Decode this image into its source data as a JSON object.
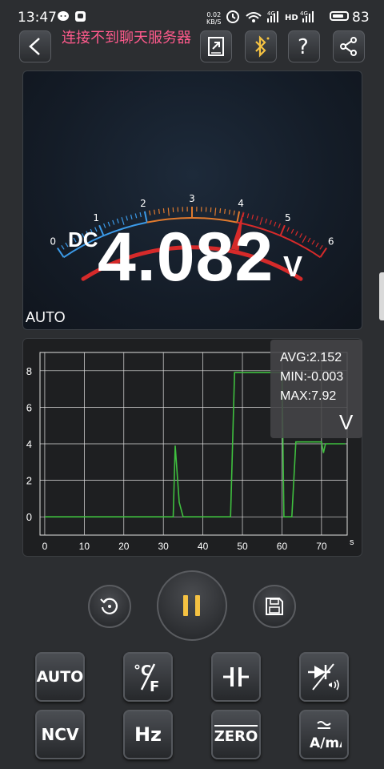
{
  "status_bar": {
    "time": "13:47",
    "net_speed": "0.02",
    "net_unit": "KB/S",
    "battery": "83",
    "battery_level": 0.83
  },
  "toolbar": {
    "title": "连接不到聊天服务器"
  },
  "meter": {
    "scale_labels": [
      "0",
      "1",
      "2",
      "3",
      "4",
      "5",
      "6"
    ],
    "needle_value": 4.082,
    "mode": "DC",
    "reading": "4.082",
    "unit": "V",
    "range": "AUTO",
    "colors": {
      "low": "#3b9ae8",
      "mid": "#e07a2e",
      "high": "#d62a2a"
    }
  },
  "graph": {
    "y_ticks": [
      "0",
      "2",
      "4",
      "6",
      "8"
    ],
    "x_ticks": [
      "0",
      "10",
      "20",
      "30",
      "40",
      "50",
      "60",
      "70"
    ],
    "x_unit": "s",
    "trace_color": "#3fbf3f",
    "trace": [
      [
        0,
        0
      ],
      [
        32.5,
        0
      ],
      [
        33,
        3.9
      ],
      [
        34,
        0.8
      ],
      [
        35,
        0
      ],
      [
        47,
        0
      ],
      [
        48,
        7.9
      ],
      [
        60,
        7.9
      ],
      [
        60.5,
        0
      ],
      [
        62.5,
        0
      ],
      [
        63.5,
        4.1
      ],
      [
        70,
        4.1
      ],
      [
        70.5,
        3.5
      ],
      [
        71,
        4.0
      ],
      [
        76,
        4.0
      ]
    ],
    "avg": "AVG:2.152",
    "min": "MIN:-0.003",
    "max": "MAX:7.92",
    "unit": "V"
  },
  "controls": {
    "accent": "#f5c242"
  },
  "keys": [
    "AUTO",
    "NCV",
    "Hz",
    "ZERO"
  ]
}
